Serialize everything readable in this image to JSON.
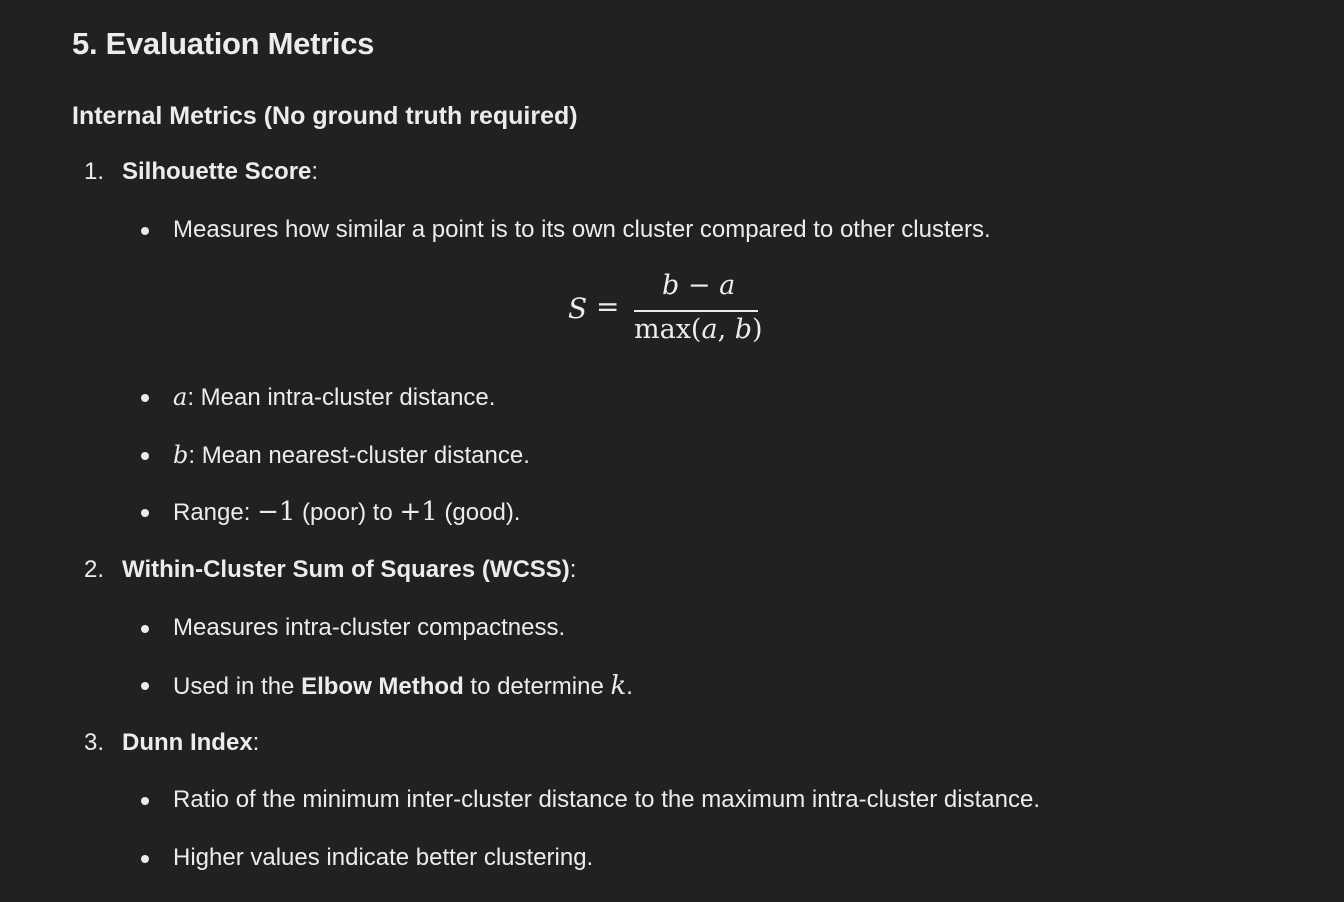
{
  "section": {
    "title": "5. Evaluation Metrics",
    "subtitle": "Internal Metrics (No ground truth required)"
  },
  "metrics": [
    {
      "number": "1.",
      "name": "Silhouette Score",
      "suffix": ":",
      "bullets": {
        "b1": "Measures how similar a point is to its own cluster compared to other clusters.",
        "b2_var": "a",
        "b2_text": ": Mean intra-cluster distance.",
        "b3_var": "b",
        "b3_text": ": Mean nearest-cluster distance.",
        "b4_pre": "Range: ",
        "b4_lo": "−1",
        "b4_mid": " (poor) to ",
        "b4_hi": "+1",
        "b4_post": " (good)."
      },
      "formula": {
        "lhs": "S",
        "eq": "=",
        "numerator": "b − a",
        "denominator": "max(a, b)"
      }
    },
    {
      "number": "2.",
      "name": "Within-Cluster Sum of Squares (WCSS)",
      "suffix": ":",
      "bullets": {
        "b1": "Measures intra-cluster compactness.",
        "b2_pre": "Used in the ",
        "b2_bold": "Elbow Method",
        "b2_mid": " to determine ",
        "b2_var": "k",
        "b2_post": "."
      }
    },
    {
      "number": "3.",
      "name": "Dunn Index",
      "suffix": ":",
      "bullets": {
        "b1": "Ratio of the minimum inter-cluster distance to the maximum intra-cluster distance.",
        "b2": "Higher values indicate better clustering."
      }
    }
  ]
}
